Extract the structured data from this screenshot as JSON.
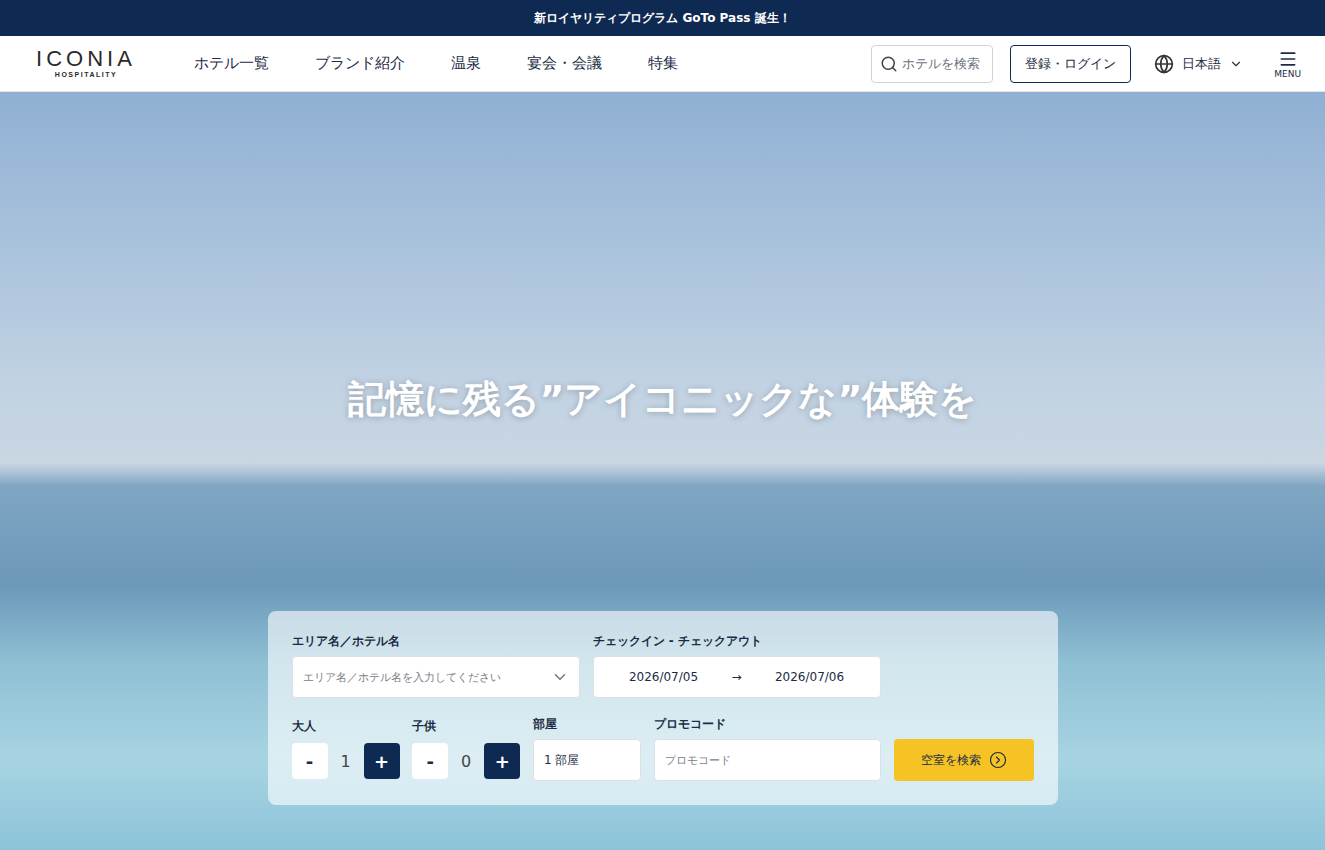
{
  "banner": {
    "text": "新ロイヤリティプログラム GoTo Pass 誕生！"
  },
  "logo": {
    "name": "ICONIA",
    "sub": "HOSPITALITY"
  },
  "nav": {
    "items": [
      "ホテル一覧",
      "ブランド紹介",
      "温泉",
      "宴会・会議",
      "特集"
    ]
  },
  "header_search": {
    "placeholder": "ホテルを検索"
  },
  "login": {
    "label": "登録・ログイン"
  },
  "language": {
    "label": "日本語"
  },
  "menu": {
    "label": "MENU"
  },
  "hero": {
    "heading": "記憶に残る”アイコニックな”体験を"
  },
  "form": {
    "area": {
      "label": "エリア名／ホテル名",
      "placeholder": "エリア名／ホテル名を入力してください"
    },
    "dates": {
      "label": "チェックイン - チェックアウト",
      "checkin": "2026/07/05",
      "arrow": "→",
      "checkout": "2026/07/06"
    },
    "counters": [
      {
        "label": "大人",
        "value": "1",
        "minus": "-",
        "plus": "+"
      },
      {
        "label": "子供",
        "value": "0",
        "minus": "-",
        "plus": "+"
      }
    ],
    "rooms": {
      "label": "部屋",
      "value": "1 部屋"
    },
    "promo": {
      "label": "プロモコード",
      "placeholder": "プロモコード"
    },
    "submit": {
      "label": "空室を検索"
    }
  }
}
